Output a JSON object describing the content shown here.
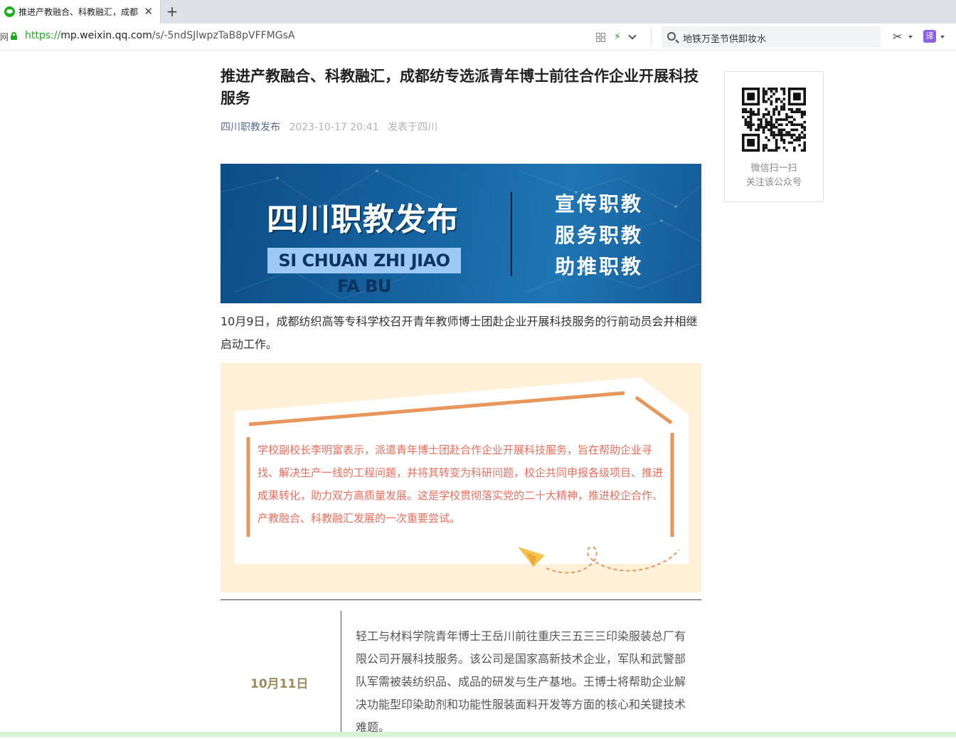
{
  "browser": {
    "tab_title": "推进产教融合、科教融汇，成都",
    "tab_close": "✕",
    "new_tab": "+",
    "left_clip": "网",
    "url_scheme": "https://",
    "url_host": "mp.weixin.qq.com",
    "url_path": "/s/-5ndSJlwpzTaB8pVFFMGsA",
    "search_text": "地铁万圣节供卸妆水",
    "translate_label": "译"
  },
  "article": {
    "title": "推进产教融合、科教融汇，成都纺专选派青年博士前往合作企业开展科技服务",
    "author": "四川职教发布",
    "date": "2023-10-17 20:41",
    "location": "发表于四川",
    "banner": {
      "brand": "四川职教发布",
      "brand_sub": "SI CHUAN ZHI JIAO FA BU",
      "slogans": [
        "宣传职教",
        "服务职教",
        "助推职教"
      ]
    },
    "para1": "10月9日，成都纺织高等专科学校召开青年教师博士团赴企业开展科技服务的行前动员会并相继启动工作。",
    "quote": "学校副校长李明富表示，派遣青年博士团赴合作企业开展科技服务，旨在帮助企业寻找、解决生产一线的工程问题，并将其转变为科研问题，校企共同申报各级项目、推进成果转化，助力双方高质量发展。这是学校贯彻落实党的二十大精神，推进校企合作、产教融合、科教融汇发展的一次重要尝试。",
    "section_date": "10月11日",
    "para2": "轻工与材料学院青年博士王岳川前往重庆三五三三印染服装总厂有限公司开展科技服务。该公司是国家高新技术企业，军队和武警部队军需被装纺织品、成品的研发与生产基地。王博士将帮助企业解决功能型印染助剂和功能性服装面料开发等方面的核心和关键技术难题。"
  },
  "qr_panel": {
    "caption_line1": "微信扫一扫",
    "caption_line2": "关注该公众号"
  },
  "colors": {
    "wechat_green": "#1aad19",
    "author_blue": "#576b95",
    "quote_red": "#e8705e",
    "date_gold": "#9b8d5d",
    "card_bg": "#fff1d8",
    "orange_stroke": "#e9965c"
  }
}
